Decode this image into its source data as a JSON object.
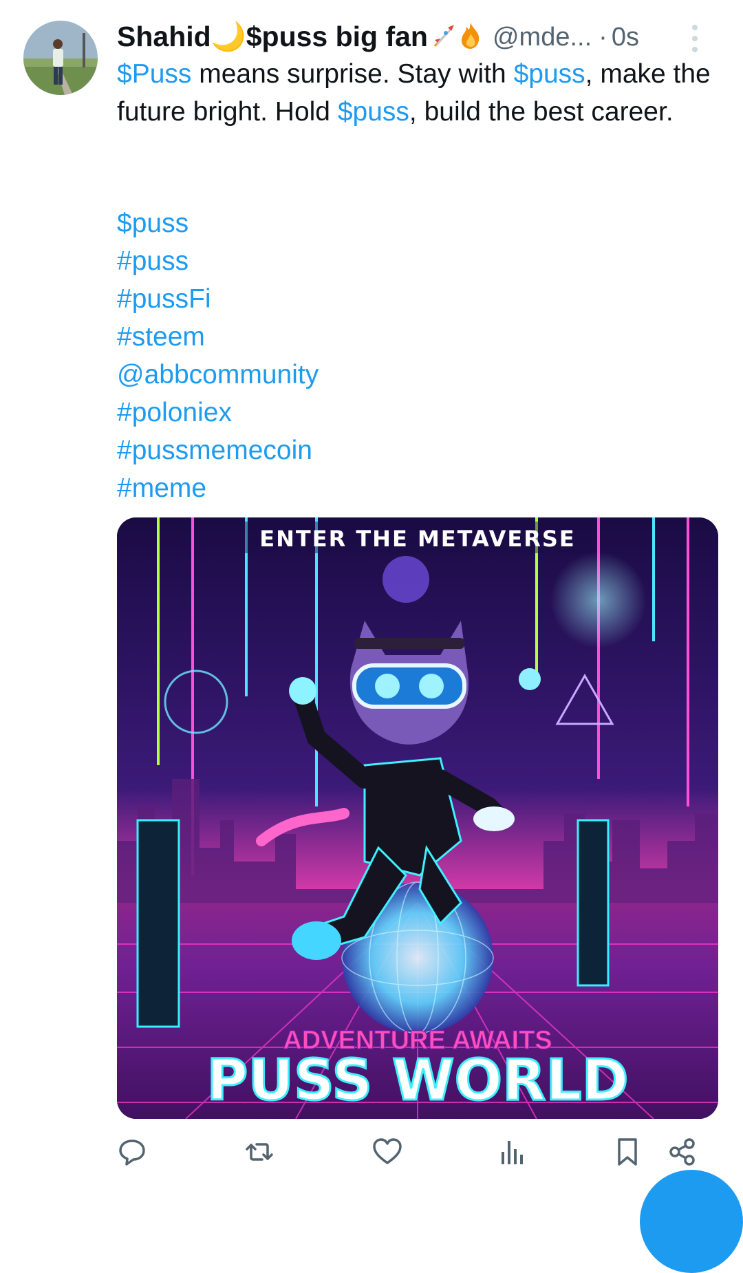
{
  "tweet": {
    "display_name": "Shahid🌙$puss big fan",
    "handle": "@mde...",
    "separator": "·",
    "time": "0s",
    "body_parts": [
      {
        "text": "$Puss",
        "link": true
      },
      {
        "text": " means surprise.  Stay with ",
        "link": false
      },
      {
        "text": "$puss",
        "link": true
      },
      {
        "text": ", make the future bright. Hold ",
        "link": false
      },
      {
        "text": "$puss",
        "link": true
      },
      {
        "text": ", build the best career.",
        "link": false
      }
    ],
    "tags": [
      "$puss",
      "#puss",
      "#pussFi",
      "#steem",
      "@abbcommunity",
      "#poloniex",
      "#pussmemecoin",
      "#meme"
    ]
  },
  "media": {
    "top_text": "ENTER THE METAVERSE",
    "subtitle": "ADVENTURE AWAITS",
    "title": "PUSS WORLD"
  },
  "icons": {
    "rocket": "rocket-icon",
    "fire": "fire-icon",
    "reply": "reply-icon",
    "retweet": "retweet-icon",
    "like": "heart-icon",
    "views": "views-icon",
    "bookmark": "bookmark-icon",
    "share": "share-icon"
  },
  "colors": {
    "link": "#1d9bf0",
    "secondary_text": "#536471",
    "icon": "#536471"
  }
}
